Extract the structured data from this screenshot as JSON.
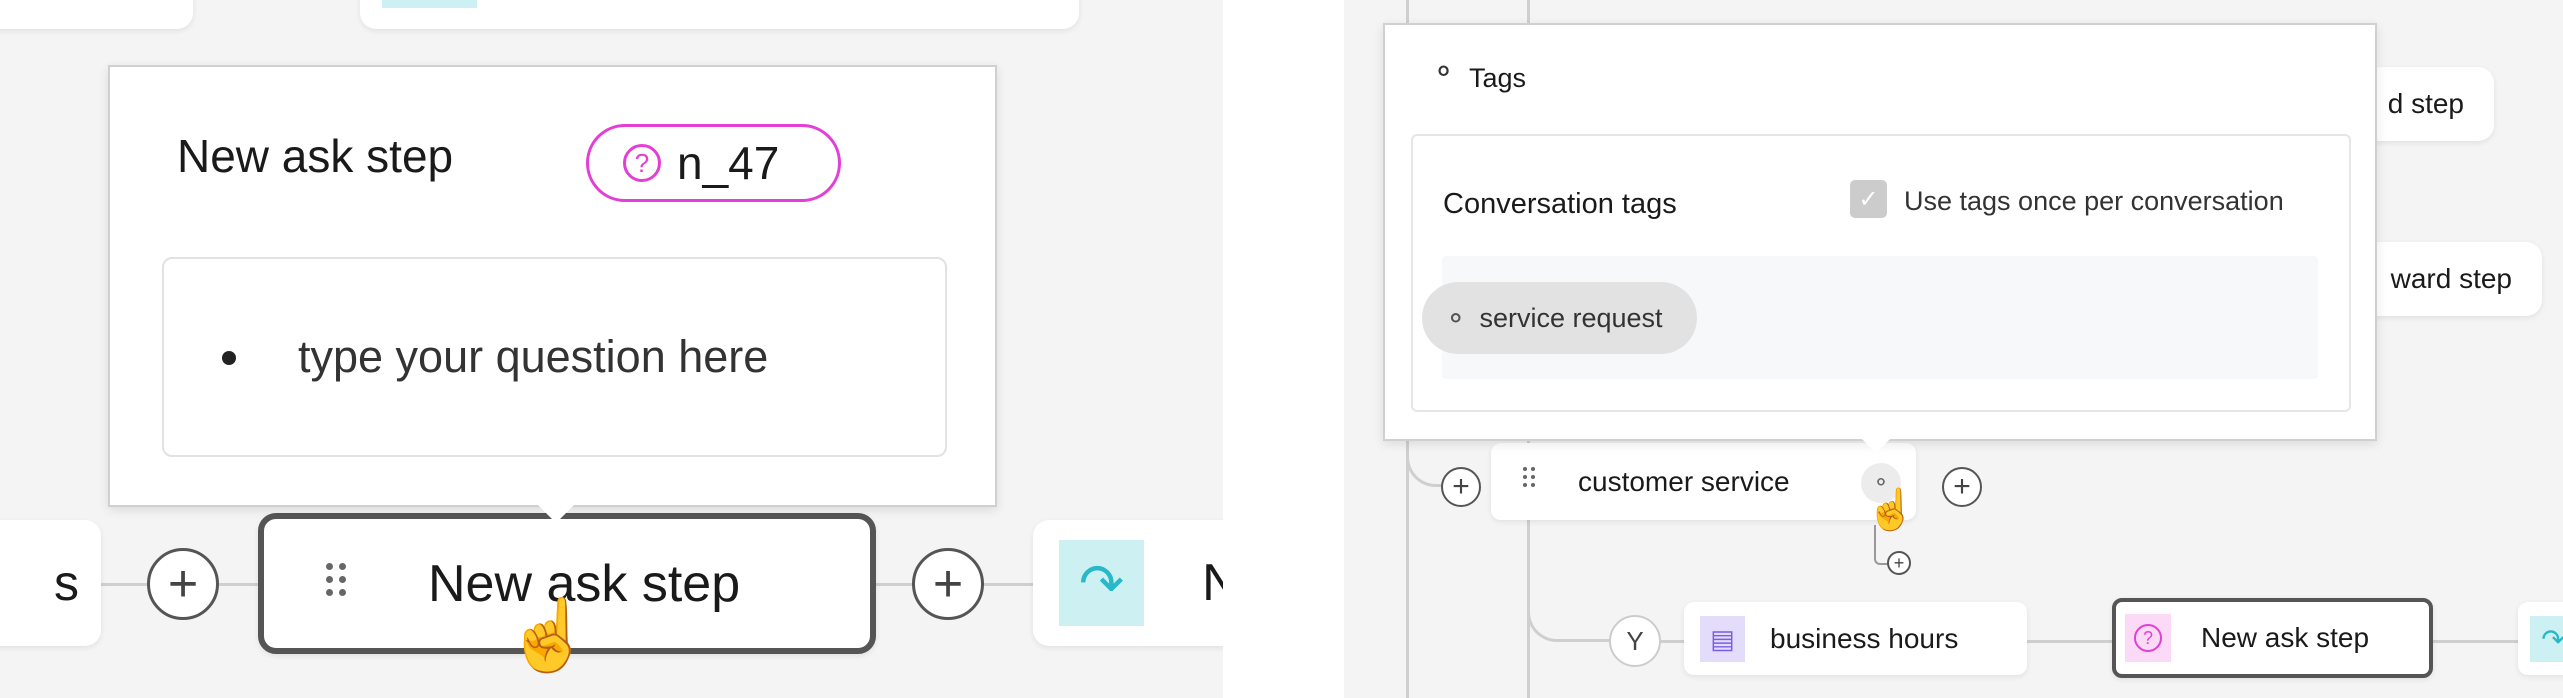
{
  "left": {
    "popover": {
      "title": "New ask step",
      "badge_id": "n_47",
      "badge_icon": "question-circle-icon",
      "question_placeholder": "type your question here"
    },
    "nodes": {
      "prev_partial": "s",
      "current": "New ask step",
      "next_partial": "N"
    },
    "colors": {
      "badge_border": "#e33fd6",
      "forward_icon_bg": "#cdf0f2",
      "forward_icon": "#28b9c9"
    }
  },
  "right": {
    "popover": {
      "title": "Tags",
      "section_title": "Conversation tags",
      "checkbox_label": "Use tags once per conversation",
      "checkbox_checked": true,
      "tags": [
        "service request"
      ]
    },
    "bg_nodes": {
      "top": "d step",
      "middle": "ward step"
    },
    "nodes": {
      "customer_service": "customer service",
      "business_hours": "business hours",
      "ask_step": "New ask step"
    },
    "colors": {
      "message_icon_bg": "#e4dcfb",
      "message_icon": "#7b5ce6",
      "ask_icon_bg": "#fbd9f7",
      "ask_icon": "#e33fd6"
    }
  }
}
